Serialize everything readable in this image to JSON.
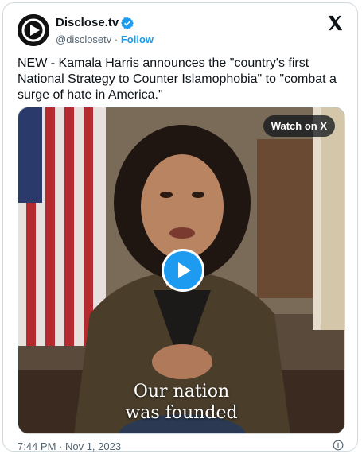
{
  "account": {
    "display_name": "Disclose.tv",
    "handle": "@disclosetv",
    "separator": " · ",
    "follow_label": "Follow"
  },
  "tweet": {
    "text": "NEW - Kamala Harris announces the \"country's first National Strategy to Counter Islamophobia\" to \"combat a surge of hate in America.\""
  },
  "media": {
    "watch_label": "Watch on X",
    "caption_line1": "Our nation",
    "caption_line2": "was founded"
  },
  "footer": {
    "timestamp": "7:44 PM · Nov 1, 2023"
  },
  "icons": {
    "verified": "verified-badge-icon",
    "x_logo": "x-logo-icon",
    "play": "play-icon",
    "info": "info-icon"
  },
  "colors": {
    "accent": "#1d9bf0",
    "text": "#0f1419",
    "muted": "#536471",
    "border": "#cfd9de"
  }
}
